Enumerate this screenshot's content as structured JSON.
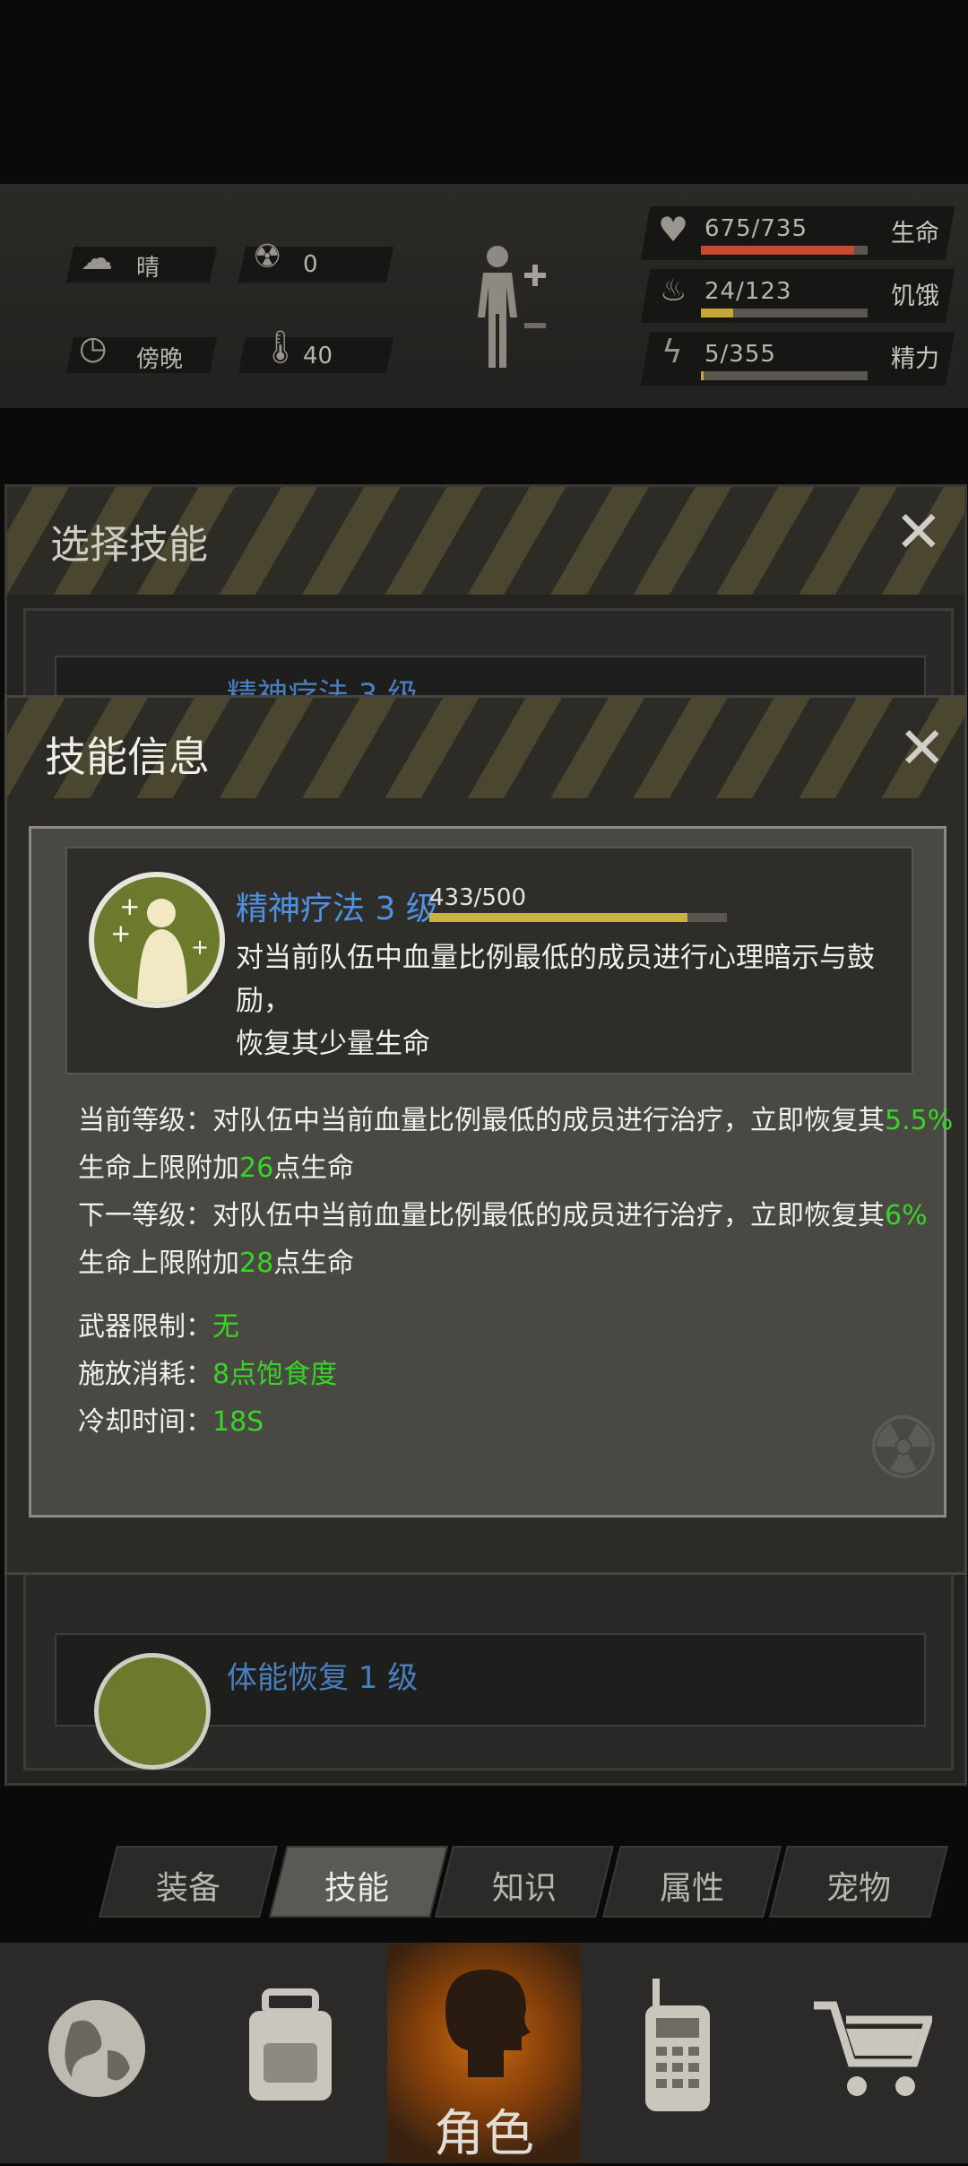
{
  "status": {
    "weather": "晴",
    "radiation": "0",
    "time_of_day": "傍晚",
    "temperature": "40"
  },
  "vitals": [
    {
      "value": "675/735",
      "name": "生命",
      "fraction": 0.918,
      "color": "#c44b33"
    },
    {
      "value": "24/123",
      "name": "饥饿",
      "fraction": 0.195,
      "color": "#c7a637"
    },
    {
      "value": "5/355",
      "name": "精力",
      "fraction": 0.014,
      "color": "#c7a637"
    }
  ],
  "back_panel": {
    "title": "选择技能",
    "items": [
      {
        "name": "精神疗法 3 级"
      },
      {
        "name": "体能恢复 1 级"
      }
    ]
  },
  "dialog": {
    "title": "技能信息",
    "skill": {
      "name": "精神疗法 3 级",
      "xp": "433/500",
      "xp_fraction": 0.866,
      "desc_line1": "对当前队伍中血量比例最低的成员进行心理暗示与鼓励，",
      "desc_line2": "恢复其少量生命"
    },
    "current": {
      "prefix": "当前等级：对队伍中当前血量比例最低的成员进行治疗，立即恢复其",
      "pct": "5.5%",
      "line2_prefix": "生命上限附加",
      "hp": "26",
      "line2_suffix": "点生命"
    },
    "next": {
      "prefix": "下一等级：对队伍中当前血量比例最低的成员进行治疗，立即恢复其",
      "pct": "6%",
      "line2_prefix": "生命上限附加",
      "hp": "28",
      "line2_suffix": "点生命"
    },
    "weapon_label": "武器限制：",
    "weapon_value": "无",
    "cost_label": "施放消耗：",
    "cost_value": "8点饱食度",
    "cooldown_label": "冷却时间：",
    "cooldown_value": "18S"
  },
  "tabs": [
    {
      "label": "装备",
      "active": false
    },
    {
      "label": "技能",
      "active": true
    },
    {
      "label": "知识",
      "active": false
    },
    {
      "label": "属性",
      "active": false
    },
    {
      "label": "宠物",
      "active": false
    }
  ],
  "nav": {
    "active_label": "角色",
    "items": [
      "globe-icon",
      "backpack-icon",
      "character-icon",
      "radio-icon",
      "shop-cart-icon"
    ]
  }
}
